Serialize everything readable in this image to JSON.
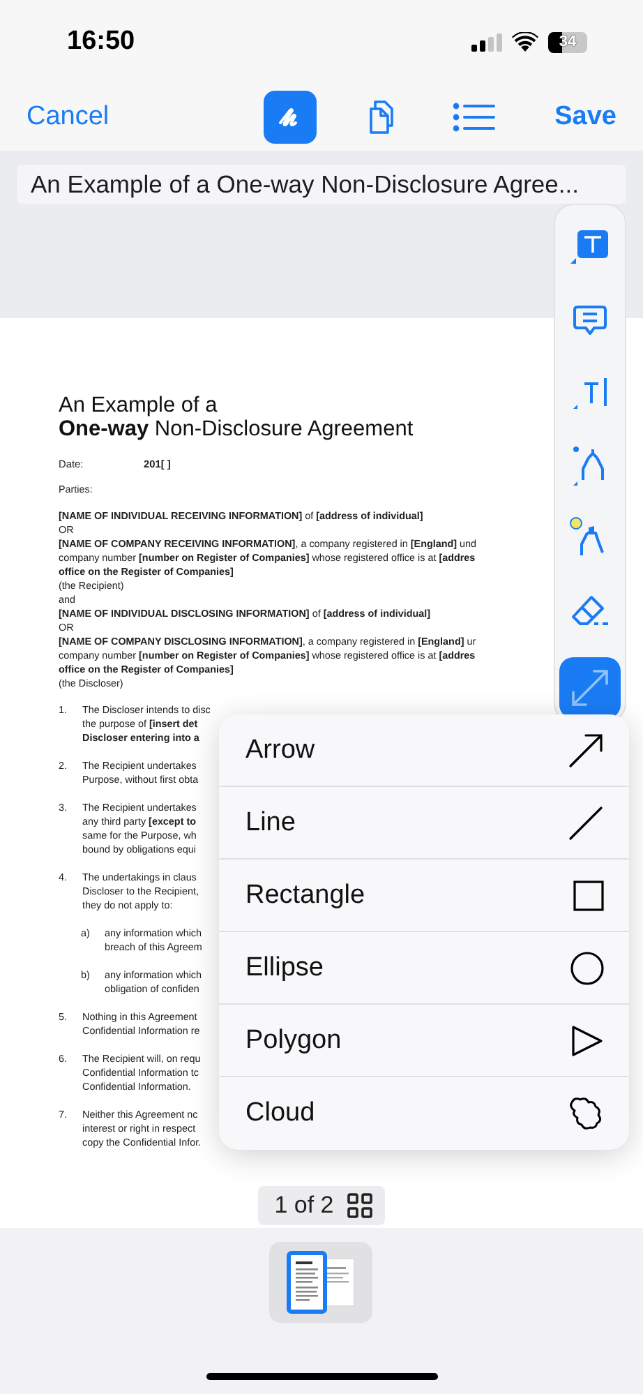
{
  "status_bar": {
    "time": "16:50",
    "battery": "34"
  },
  "nav_bar": {
    "cancel": "Cancel",
    "save": "Save",
    "tools": [
      {
        "kind": "markup",
        "selected": true
      },
      {
        "kind": "pages",
        "selected": false
      },
      {
        "kind": "outline",
        "selected": false
      }
    ]
  },
  "document_title": "An Example of a One-way Non-Disclosure Agree...",
  "document": {
    "heading": [
      "An Example of a",
      "**One-way** Non-Disclosure Agreement"
    ],
    "date_label": "Date:",
    "date_value": "201[ ]",
    "parties_label": "Parties:",
    "parties": [
      "**[NAME OF INDIVIDUAL RECEIVING INFORMATION]** of **[address of individual]**",
      "OR",
      "**[NAME OF COMPANY RECEIVING INFORMATION]**, a company registered in **[England]** und",
      "company number **[number on Register of Companies]** whose registered office is at **[addres**",
      "**office on the Register of Companies]**",
      "(the Recipient)",
      "and",
      "**[NAME OF INDIVIDUAL DISCLOSING INFORMATION]** of **[address of individual]**",
      "OR",
      "**[NAME OF COMPANY DISCLOSING INFORMATION]**, a company registered in **[England]** ur",
      "company number **[number on Register of Companies]** whose registered office is at **[addres**",
      "**office on the Register of Companies]**",
      "(the Discloser)"
    ],
    "clauses": [
      {
        "number": "1.",
        "lines": [
          "The Discloser intends to disc",
          "the purpose of **[insert det**",
          "**Discloser entering into a**"
        ]
      },
      {
        "number": "2.",
        "lines": [
          "The Recipient undertakes",
          "Purpose, without first obta"
        ]
      },
      {
        "number": "3.",
        "lines": [
          "The Recipient undertakes",
          "any third party **[except to**",
          "same for the Purpose, wh",
          "bound by obligations equi"
        ]
      },
      {
        "number": "4.",
        "lines": [
          "The undertakings in claus",
          "Discloser to the Recipient,",
          "they do not apply to:"
        ],
        "children": [
          {
            "number": "a)",
            "lines": [
              "any information which",
              "breach of this Agreem"
            ]
          },
          {
            "number": "b)",
            "lines": [
              "any information which",
              "obligation of confiden"
            ]
          }
        ]
      },
      {
        "number": "5.",
        "lines": [
          "Nothing in this Agreement",
          "Confidential Information re"
        ]
      },
      {
        "number": "6.",
        "lines": [
          "The Recipient will, on requ",
          "Confidential Information tc",
          "Confidential Information."
        ]
      },
      {
        "number": "7.",
        "lines": [
          "Neither this Agreement nc",
          "interest or right in respect",
          "copy the Confidential Infor."
        ]
      }
    ]
  },
  "markup_tools": [
    {
      "kind": "text-box",
      "selected": false
    },
    {
      "kind": "note",
      "selected": false
    },
    {
      "kind": "text",
      "selected": false
    },
    {
      "kind": "pen",
      "selected": false
    },
    {
      "kind": "highlighter",
      "selected": false,
      "color": "#f7e463"
    },
    {
      "kind": "eraser",
      "selected": false
    },
    {
      "kind": "shape",
      "selected": true
    }
  ],
  "shape_menu": [
    {
      "label": "Arrow",
      "kind": "arrow"
    },
    {
      "label": "Line",
      "kind": "line"
    },
    {
      "label": "Rectangle",
      "kind": "rectangle"
    },
    {
      "label": "Ellipse",
      "kind": "ellipse"
    },
    {
      "label": "Polygon",
      "kind": "polygon"
    },
    {
      "label": "Cloud",
      "kind": "cloud"
    }
  ],
  "page_indicator": "1 of 2"
}
